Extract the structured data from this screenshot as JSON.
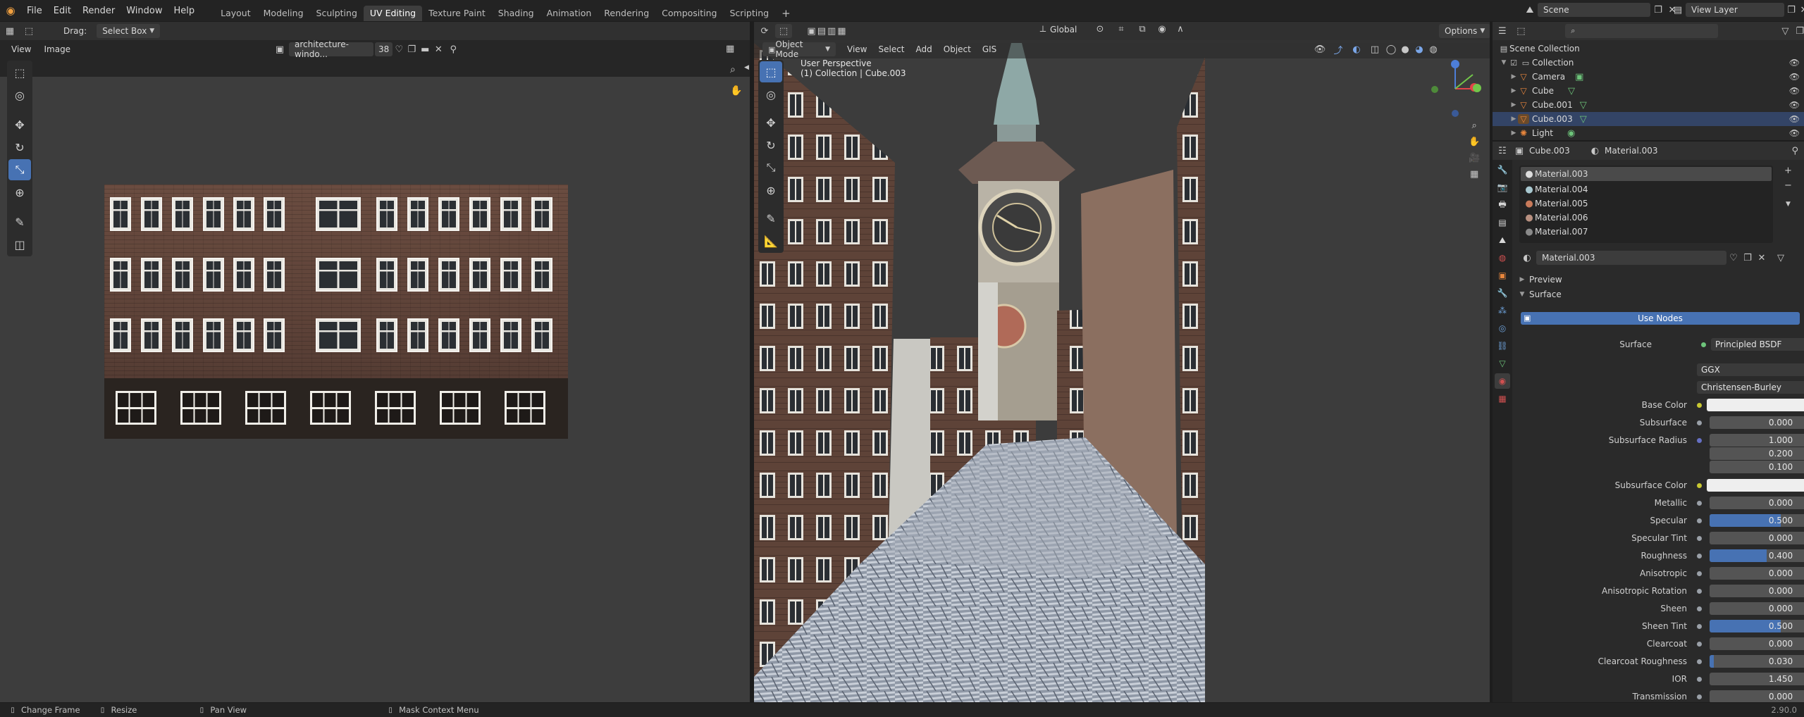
{
  "menu": {
    "items": [
      "File",
      "Edit",
      "Render",
      "Window",
      "Help"
    ],
    "workspaces": [
      "Layout",
      "Modeling",
      "Sculpting",
      "UV Editing",
      "Texture Paint",
      "Shading",
      "Animation",
      "Rendering",
      "Compositing",
      "Scripting"
    ],
    "active_workspace": "UV Editing",
    "add_tab": "+",
    "scene_label": "Scene",
    "view_layer_label": "View Layer"
  },
  "uv_editor": {
    "drag_label": "Drag:",
    "drag_value": "Select Box",
    "view_menu": "View",
    "image_menu": "Image",
    "image_name": "architecture-windo...",
    "image_users": "38"
  },
  "viewport": {
    "mode": "Object Mode",
    "menus": [
      "View",
      "Select",
      "Add",
      "Object",
      "GIS"
    ],
    "orientation": "Global",
    "options_label": "Options",
    "perspective_text": "User Perspective",
    "collection_text": "(1) Collection | Cube.003"
  },
  "outliner": {
    "root": "Scene Collection",
    "collection": "Collection",
    "items": [
      "Camera",
      "Cube",
      "Cube.001",
      "Cube.003",
      "Light"
    ]
  },
  "properties": {
    "object_name": "Cube.003",
    "material_header": "Material.003",
    "material_slots": [
      "Material.003",
      "Material.004",
      "Material.005",
      "Material.006",
      "Material.007"
    ],
    "material_field": "Material.003",
    "preview_label": "Preview",
    "surface_panel": "Surface",
    "use_nodes": "Use Nodes",
    "surface_label": "Surface",
    "surface_shader": "Principled BSDF",
    "distribution": "GGX",
    "subsurface_method": "Christensen-Burley",
    "base_color_label": "Base Color",
    "subsurface_label": "Subsurface",
    "subsurface_value": "0.000",
    "subsurface_radius_label": "Subsurface Radius",
    "subsurface_radius": [
      "1.000",
      "0.200",
      "0.100"
    ],
    "subsurface_color_label": "Subsurface Color",
    "params": [
      {
        "label": "Metallic",
        "value": "0.000",
        "fill": 0
      },
      {
        "label": "Specular",
        "value": "0.500",
        "fill": 0.5
      },
      {
        "label": "Specular Tint",
        "value": "0.000",
        "fill": 0
      },
      {
        "label": "Roughness",
        "value": "0.400",
        "fill": 0.4
      },
      {
        "label": "Anisotropic",
        "value": "0.000",
        "fill": 0
      },
      {
        "label": "Anisotropic Rotation",
        "value": "0.000",
        "fill": 0
      },
      {
        "label": "Sheen",
        "value": "0.000",
        "fill": 0
      },
      {
        "label": "Sheen Tint",
        "value": "0.500",
        "fill": 0.5
      },
      {
        "label": "Clearcoat",
        "value": "0.000",
        "fill": 0
      },
      {
        "label": "Clearcoat Roughness",
        "value": "0.030",
        "fill": 0.03
      },
      {
        "label": "IOR",
        "value": "1.450",
        "fill": 0
      },
      {
        "label": "Transmission",
        "value": "0.000",
        "fill": 0
      }
    ]
  },
  "status": {
    "items": [
      "Change Frame",
      "Resize",
      "Pan View",
      "Mask Context Menu"
    ],
    "version": "2.90.0"
  },
  "colors": {
    "accent": "#4772b3",
    "object_orange": "#e8863c"
  }
}
